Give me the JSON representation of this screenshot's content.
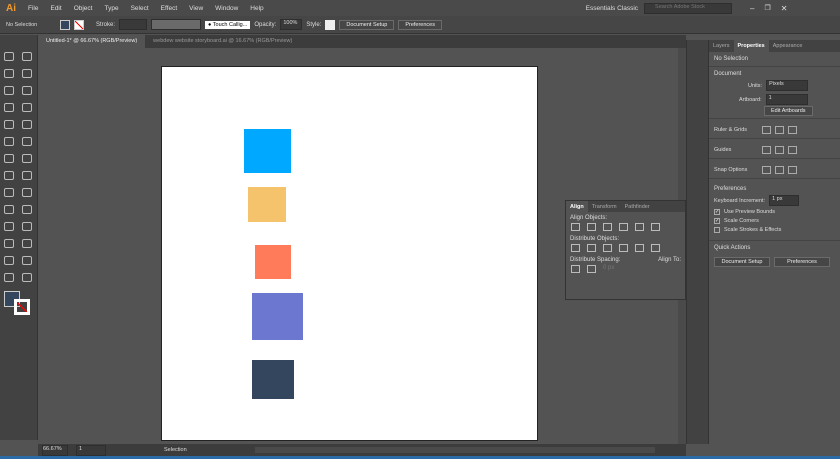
{
  "app": {
    "logo": "Ai",
    "menu": [
      "File",
      "Edit",
      "Object",
      "Type",
      "Select",
      "Effect",
      "View",
      "Window",
      "Help"
    ],
    "workspace": "Essentials Classic",
    "search_placeholder": "Search Adobe Stock"
  },
  "control": {
    "selection": "No Selection",
    "stroke_label": "Stroke:",
    "brush": "Touch Callig...",
    "opacity_label": "Opacity:",
    "opacity": "100%",
    "style_label": "Style:",
    "document_setup": "Document Setup",
    "preferences": "Preferences"
  },
  "tabs": [
    {
      "label": "Untitled-1* @ 66.67% (RGB/Preview)"
    },
    {
      "label": "webdew website storyboard.ai @ 16.67% (RGB/Preview)"
    }
  ],
  "shapes": [
    {
      "color": "#00a8ff"
    },
    {
      "color": "#f5c36b"
    },
    {
      "color": "#ff7b5a"
    },
    {
      "color": "#6c78d0"
    },
    {
      "color": "#34465e"
    }
  ],
  "properties": {
    "tabs": [
      "Layers",
      "Properties",
      "Appearance"
    ],
    "no_selection": "No Selection",
    "document": "Document",
    "units_label": "Units:",
    "units": "Pixels",
    "artboard_label": "Artboard:",
    "artboard": "1",
    "edit_artboards": "Edit Artboards",
    "ruler_grids": "Ruler & Grids",
    "guides": "Guides",
    "snap_options": "Snap Options",
    "preferences": "Preferences",
    "keyboard_increment_label": "Keyboard Increment:",
    "keyboard_increment": "1 px",
    "use_preview_bounds": "Use Preview Bounds",
    "scale_corners": "Scale Corners",
    "scale_strokes": "Scale Strokes & Effects",
    "quick_actions": "Quick Actions",
    "document_setup": "Document Setup",
    "prefs_button": "Preferences"
  },
  "align": {
    "tabs": [
      "Align",
      "Transform",
      "Pathfinder"
    ],
    "align_objects": "Align Objects:",
    "distribute_objects": "Distribute Objects:",
    "distribute_spacing": "Distribute Spacing:",
    "align_to": "Align To:",
    "spacing": "0 px"
  },
  "status": {
    "zoom": "66.67%",
    "artboard": "1",
    "tool": "Selection"
  }
}
